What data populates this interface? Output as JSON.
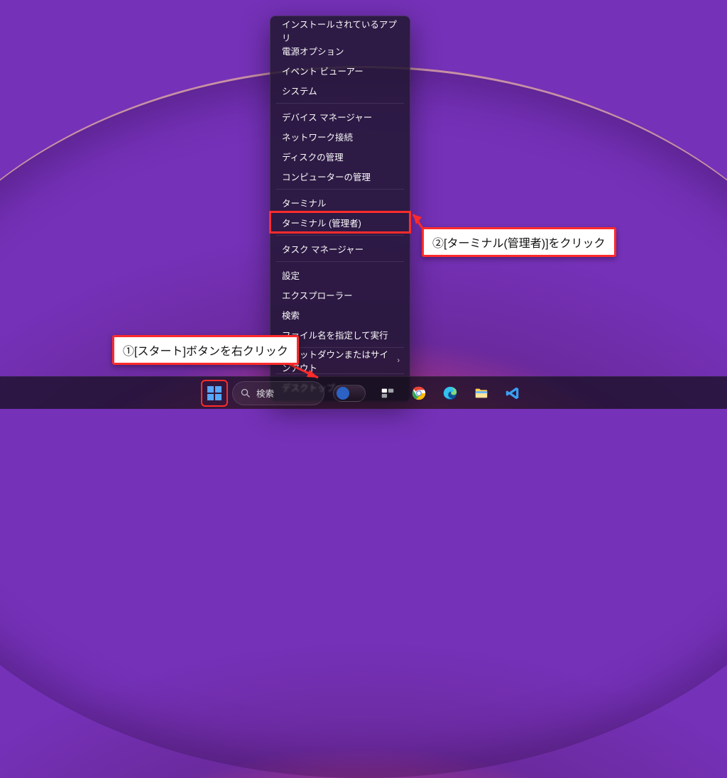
{
  "context_menu": {
    "items": [
      {
        "label": "インストールされているアプリ",
        "separator_after": false
      },
      {
        "label": "電源オプション",
        "separator_after": false
      },
      {
        "label": "イベント ビューアー",
        "separator_after": false
      },
      {
        "label": "システム",
        "separator_after": true
      },
      {
        "label": "デバイス マネージャー",
        "separator_after": false
      },
      {
        "label": "ネットワーク接続",
        "separator_after": false
      },
      {
        "label": "ディスクの管理",
        "separator_after": false
      },
      {
        "label": "コンピューターの管理",
        "separator_after": true
      },
      {
        "label": "ターミナル",
        "separator_after": false
      },
      {
        "label": "ターミナル (管理者)",
        "separator_after": true,
        "highlight": true
      },
      {
        "label": "タスク マネージャー",
        "separator_after": true
      },
      {
        "label": "設定",
        "separator_after": false
      },
      {
        "label": "エクスプローラー",
        "separator_after": false
      },
      {
        "label": "検索",
        "separator_after": false
      },
      {
        "label": "ファイル名を指定して実行",
        "separator_after": true
      },
      {
        "label": "シャットダウンまたはサインアウト",
        "separator_after": true,
        "submenu": true
      },
      {
        "label": "デスクトップ",
        "separator_after": false
      }
    ]
  },
  "annotations": {
    "step1": "①[スタート]ボタンを右クリック",
    "step2": "②[ターミナル(管理者)]をクリック"
  },
  "taskbar": {
    "search_label": "検索"
  }
}
